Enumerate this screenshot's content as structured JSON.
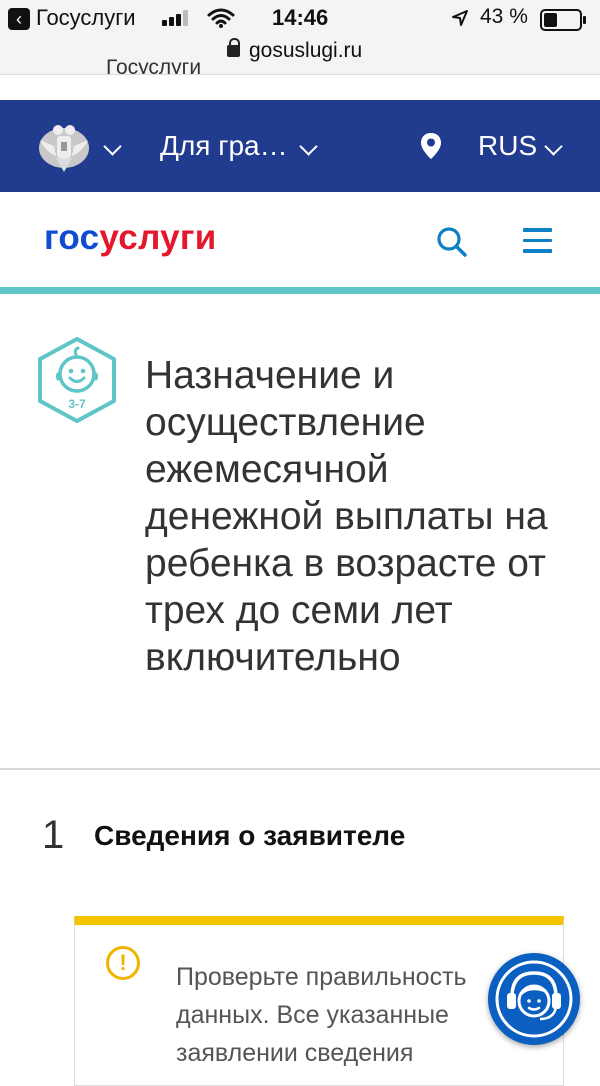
{
  "status_bar": {
    "back_app": "Госуслуги",
    "time": "14:46",
    "battery_percent": "43 %",
    "battery_level": 0.43
  },
  "browser": {
    "url": "gosuslugi.ru",
    "clipped_title": "Госуслуги"
  },
  "header": {
    "audience_label": "Для гра…",
    "language": "RUS"
  },
  "logo": {
    "part1": "гос",
    "part2": "услуги"
  },
  "colors": {
    "header_bg": "#213b8f",
    "logo_blue": "#0d4cd3",
    "logo_red": "#e4172d",
    "accent_teal": "#5ec5c8",
    "warning_yellow": "#f5c400"
  },
  "service": {
    "icon_age": "3-7",
    "title": "Назначение и осуществление ежемесячной денежной выплаты на ребенка в возрасте от трех до семи лет включительно"
  },
  "step": {
    "number": "1",
    "title": "Сведения о заявителе"
  },
  "warning": {
    "lines": [
      "Проверьте правильность",
      "данных. Все указанные",
      "заявлении сведения"
    ]
  },
  "icons": [
    "back-icon",
    "signal-icon",
    "wifi-icon",
    "location-arrow-icon",
    "battery-icon",
    "lock-icon",
    "emblem-icon",
    "chevron-down-icon",
    "map-pin-icon",
    "search-icon",
    "menu-icon",
    "child-icon",
    "warning-icon",
    "support-chat-icon"
  ]
}
